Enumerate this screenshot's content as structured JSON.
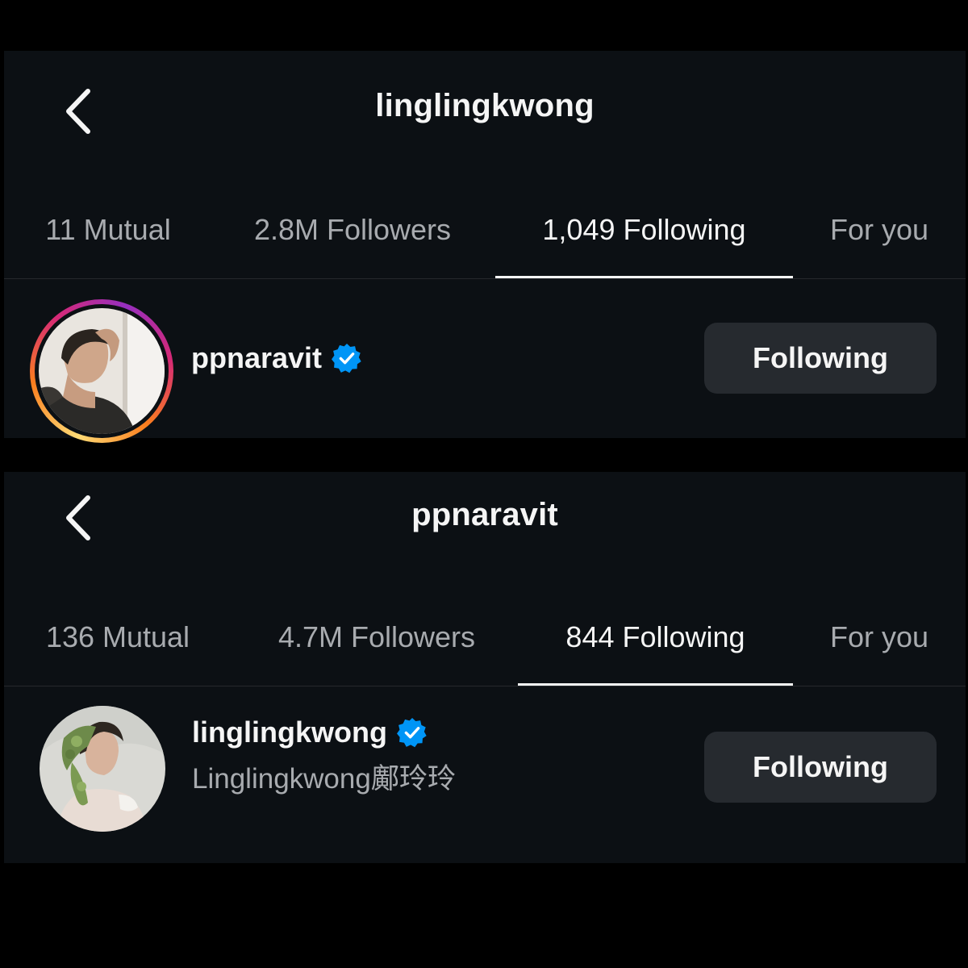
{
  "screens": [
    {
      "title": "linglingkwong",
      "tabs": [
        {
          "label": "11 Mutual"
        },
        {
          "label": "2.8M Followers"
        },
        {
          "label": "1,049 Following",
          "active": true
        },
        {
          "label": "For you"
        }
      ],
      "row": {
        "avatar": "profile-photo-man-hand-in-hair",
        "has_story_ring": true,
        "username": "ppnaravit",
        "verified": true,
        "fullname": "",
        "button_label": "Following"
      }
    },
    {
      "title": "ppnaravit",
      "tabs": [
        {
          "label": "136 Mutual"
        },
        {
          "label": "4.7M Followers"
        },
        {
          "label": "844 Following",
          "active": true
        },
        {
          "label": "For you"
        }
      ],
      "row": {
        "avatar": "profile-photo-woman-with-leaves",
        "has_story_ring": false,
        "username": "linglingkwong",
        "verified": true,
        "fullname": "Linglingkwong鄺玲玲",
        "button_label": "Following"
      }
    }
  ],
  "colors": {
    "background": "#000000",
    "panel": "#0c1014",
    "text_primary": "#f5f5f5",
    "text_secondary": "#a8abaf",
    "button_bg": "#262a2f",
    "verified_blue": "#0095f6"
  }
}
